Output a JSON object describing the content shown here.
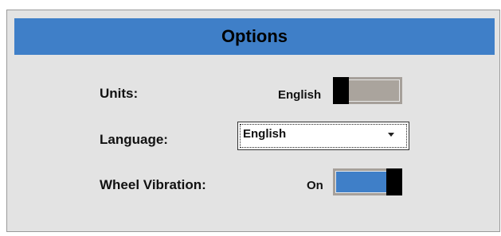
{
  "dialog": {
    "title": "Options"
  },
  "settings": {
    "units": {
      "label": "Units:",
      "value": "English",
      "toggle_on": false
    },
    "language": {
      "label": "Language:",
      "selected": "English"
    },
    "wheel_vibration": {
      "label": "Wheel Vibration:",
      "value": "On",
      "toggle_on": true
    }
  },
  "colors": {
    "accent": "#3f7fc8",
    "panel_background": "#e3e3e3",
    "toggle_off_fill": "#aaa49d",
    "toggle_on_fill": "#3f7fc8",
    "knob": "#000000"
  }
}
